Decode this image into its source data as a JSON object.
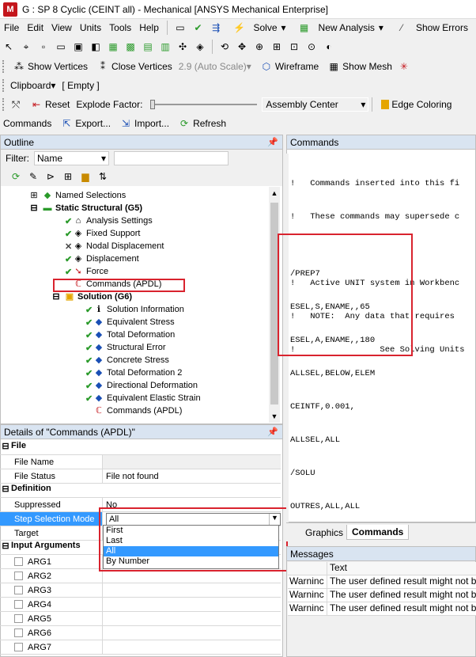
{
  "window": {
    "title": "G : SP 8 Cyclic (CEINT all) - Mechanical [ANSYS Mechanical Enterprise]",
    "logo": "M"
  },
  "menu": [
    "File",
    "Edit",
    "View",
    "Units",
    "Tools",
    "Help"
  ],
  "toolbar1": {
    "solve": "Solve",
    "new_analysis": "New Analysis",
    "show_errors": "Show Errors"
  },
  "toolbar2": {
    "show_vertices": "Show Vertices",
    "close_vertices": "Close Vertices",
    "scale": "2.9 (Auto Scale)",
    "wireframe": "Wireframe",
    "show_mesh": "Show Mesh"
  },
  "toolbar3": {
    "clipboard": "Clipboard",
    "clipboard_value": "[ Empty ]"
  },
  "toolbar4": {
    "reset": "Reset",
    "explode_factor": "Explode Factor:",
    "assembly": "Assembly Center",
    "edge_coloring": "Edge Coloring"
  },
  "toolbar5": {
    "commands": "Commands",
    "export": "Export...",
    "import": "Import...",
    "refresh": "Refresh"
  },
  "outline": {
    "title": "Outline",
    "filter_label": "Filter:",
    "filter_value": "Name",
    "items": [
      "Named Selections",
      "Static Structural (G5)",
      "Analysis Settings",
      "Fixed Support",
      "Nodal Displacement",
      "Displacement",
      "Force",
      "Commands (APDL)",
      "Solution (G6)",
      "Solution Information",
      "Equivalent Stress",
      "Total Deformation",
      "Structural Error",
      "Concrete Stress",
      "Total Deformation 2",
      "Directional Deformation",
      "Equivalent Elastic Strain",
      "Commands (APDL)"
    ]
  },
  "details": {
    "title": "Details of \"Commands (APDL)\"",
    "sec_file": "File",
    "file_name": "File Name",
    "file_status": "File Status",
    "file_status_val": "File not found",
    "sec_def": "Definition",
    "suppressed": "Suppressed",
    "suppressed_val": "No",
    "step_mode": "Step Selection Mode",
    "step_mode_val": "All",
    "target": "Target",
    "sec_input": "Input Arguments",
    "args": [
      "ARG1",
      "ARG2",
      "ARG3",
      "ARG4",
      "ARG5",
      "ARG6",
      "ARG7"
    ],
    "dropdown_options": [
      "First",
      "Last",
      "All",
      "By Number"
    ]
  },
  "commands_panel": {
    "title": "Commands",
    "header_lines": [
      "!   Commands inserted into this fi",
      "!   These commands may supersede c",
      "",
      "!   Active UNIT system in Workbenc",
      "!   NOTE:  Any data that requires",
      "!                 See Solving Units"
    ],
    "code_lines": [
      "/PREP7",
      "ESEL,S,ENAME,,65",
      "ESEL,A,ENAME,,180",
      "ALLSEL,BELOW,ELEM",
      "CEINTF,0.001,",
      "ALLSEL,ALL",
      "/SOLU",
      "OUTRES,ALL,ALL"
    ],
    "tabs": [
      "Graphics",
      "Commands"
    ]
  },
  "messages": {
    "title": "Messages",
    "col_text": "Text",
    "rows": [
      {
        "type": "Warninc",
        "text": "The user defined result might not b"
      },
      {
        "type": "Warninc",
        "text": "The user defined result might not b"
      },
      {
        "type": "Warninc",
        "text": "The user defined result might not b"
      }
    ]
  },
  "colors": {
    "highlight": "#d9232e",
    "panel_title": "#d9e4f1",
    "selection": "#3399ff",
    "check": "#2a9a2a"
  }
}
